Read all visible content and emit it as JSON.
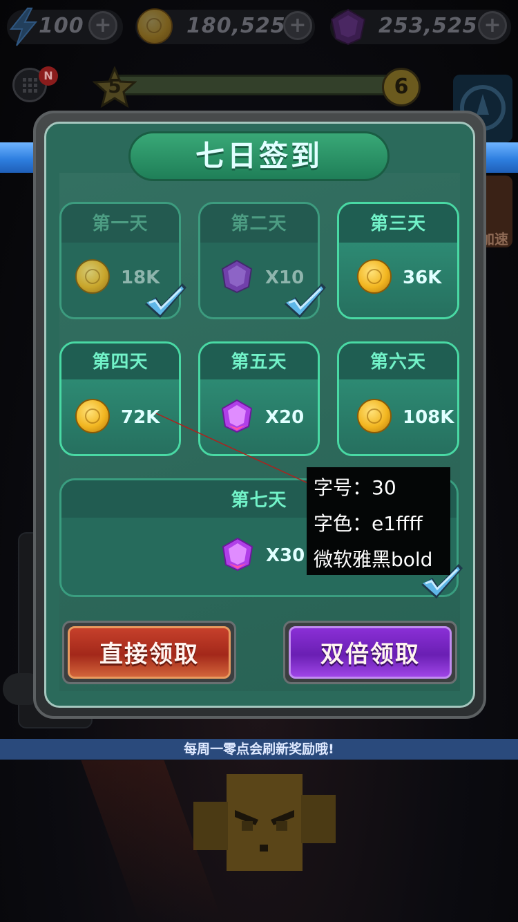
{
  "resources": [
    {
      "name": "energy",
      "icon": "lightning-icon",
      "value": "100"
    },
    {
      "name": "coins",
      "icon": "coin-icon",
      "value": "180,525"
    },
    {
      "name": "gems",
      "icon": "gem-icon",
      "value": "253,525"
    }
  ],
  "plus_symbol": "+",
  "level": {
    "current": "5",
    "next": "6"
  },
  "menu_badge": "N",
  "side_button_label": "加速",
  "dialog": {
    "title": "七日签到",
    "days": [
      {
        "label": "第一天",
        "reward_type": "coin",
        "amount": "18K",
        "claimed": true
      },
      {
        "label": "第二天",
        "reward_type": "gem",
        "amount": "X10",
        "claimed": true
      },
      {
        "label": "第三天",
        "reward_type": "coin",
        "amount": "36K",
        "claimed": false
      },
      {
        "label": "第四天",
        "reward_type": "coin",
        "amount": "72K",
        "claimed": false
      },
      {
        "label": "第五天",
        "reward_type": "gem",
        "amount": "X20",
        "claimed": false
      },
      {
        "label": "第六天",
        "reward_type": "coin",
        "amount": "108K",
        "claimed": false
      },
      {
        "label": "第七天",
        "reward_type": "gem",
        "amount": "X30",
        "claimed": true
      }
    ],
    "buttons": {
      "direct": "直接领取",
      "double": "双倍领取"
    }
  },
  "notice": "每周一零点会刷新奖励哦!",
  "annotation": {
    "size": "字号：30",
    "color": "字色：e1ffff",
    "font": "微软雅黑bold"
  },
  "colors": {
    "title_text": "#e1ffff",
    "card_border": "#49d9a4",
    "day_label": "#72f2c8",
    "annotation_line": "#b0201c"
  }
}
